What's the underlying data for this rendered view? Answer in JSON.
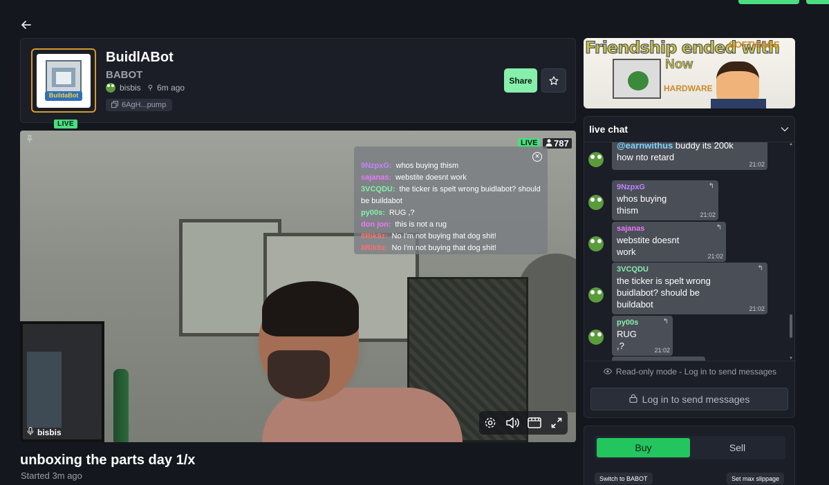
{
  "nav": {
    "back_icon": "arrow-left-icon"
  },
  "token": {
    "name": "BuidlABot",
    "ticker": "BABOT",
    "logo_text": "BuildaBot",
    "live_badge": "LIVE",
    "creator": "bisbis",
    "created_ago": "6m ago",
    "contract_address": "6AgH...pump",
    "share_label": "Share"
  },
  "video": {
    "live_label": "LIVE",
    "viewer_count": "787",
    "streamer": "bisbis",
    "overlay_messages": [
      {
        "user": "9NzpxG:",
        "text": "whos buying thism",
        "color": "#c084fc"
      },
      {
        "user": "sajanas:",
        "text": "webstite doesnt work",
        "color": "#e879f9"
      },
      {
        "user": "3VCQDU:",
        "text": "the ticker is spelt wrong buidlabot? should be buildabot",
        "color": "#86efac"
      },
      {
        "user": "py00s:",
        "text": "RUG ,?",
        "color": "#86efac"
      },
      {
        "user": "don jon:",
        "text": "this is not a rug",
        "color": "#e879f9"
      },
      {
        "user": "8Rik9z:",
        "text": "No I'm not buying that dog shit!",
        "color": "#f87171"
      },
      {
        "user": "8Rik9z:",
        "text": "No I'm not buying that dog shit!",
        "color": "#f87171"
      }
    ]
  },
  "stream": {
    "title": "unboxing the parts day 1/x",
    "started": "Started 3m ago"
  },
  "banner": {
    "line1": "Friendship ended with",
    "software": "SOFTWARE",
    "now": "Now",
    "hardware": "HARDWARE"
  },
  "chat": {
    "title": "live chat",
    "messages": [
      {
        "mention": "@earnwithus",
        "text": " buddy its 200k how nto retard",
        "time": "21:02",
        "user": "",
        "color": "#fff"
      },
      {
        "user": "9NzpxG",
        "text": "whos buying thism",
        "time": "21:02",
        "color": "#c084fc"
      },
      {
        "user": "sajanas",
        "text": "webstite doesnt work",
        "time": "21:02",
        "color": "#e879f9"
      },
      {
        "user": "3VCQDU",
        "text": "the ticker is spelt wrong buidlabot? should be buildabot",
        "time": "21:02",
        "color": "#86efac"
      },
      {
        "user": "py00s",
        "text": "RUG ,?",
        "time": "21:02",
        "color": "#86efac"
      }
    ],
    "readonly_text": "Read-only mode - Log in to send messages",
    "login_label": "Log in to send messages"
  },
  "trade": {
    "buy_label": "Buy",
    "sell_label": "Sell",
    "switch_label": "Switch to BABOT",
    "slippage_label": "Set max slippage"
  },
  "colors": {
    "accent": "#4ade80",
    "buy": "#22c55e",
    "background": "#15171e",
    "panel": "#1b1e26"
  }
}
